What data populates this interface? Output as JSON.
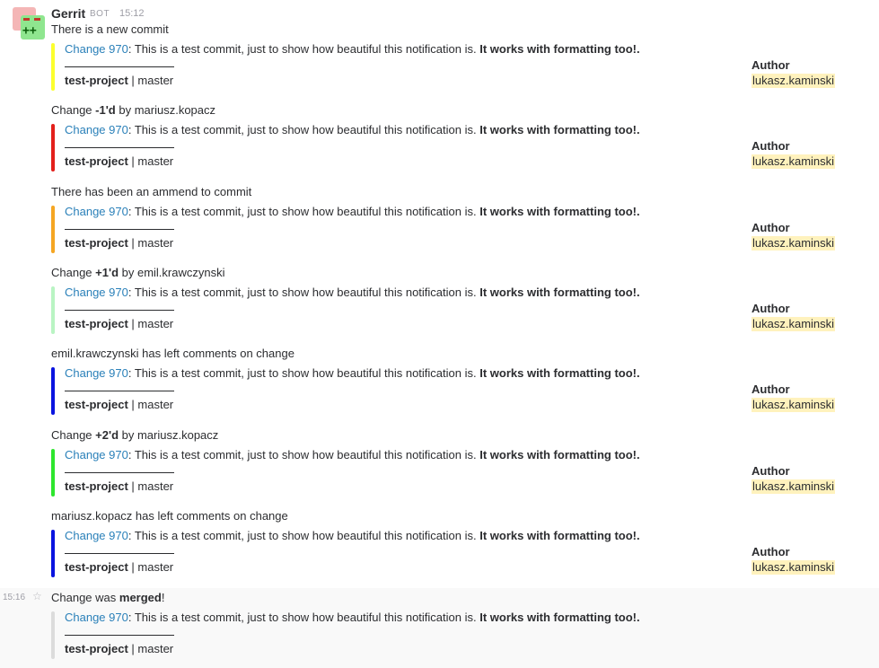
{
  "message": {
    "sender": "Gerrit",
    "bot_tag": "BOT",
    "time": "15:12"
  },
  "change_link": "Change 970",
  "change_desc": ": This is a test commit, just to show how beautiful this notification is. ",
  "change_bold": "It works with formatting too!.",
  "project": "test-project",
  "branch_sep": " | ",
  "branch": "master",
  "author_label": "Author",
  "author_value": "lukasz.kaminski",
  "notifications": [
    {
      "intro": [
        "There is a new commit"
      ],
      "bar_color": "#fcff2e"
    },
    {
      "intro": [
        "Change ",
        "-1'd",
        " by mariusz.kopacz"
      ],
      "bar_color": "#e3201b"
    },
    {
      "intro": [
        "There has been an ammend to commit"
      ],
      "bar_color": "#f5a623"
    },
    {
      "intro": [
        "Change ",
        "+1'd",
        " by emil.krawczynski"
      ],
      "bar_color": "#b9f4c3"
    },
    {
      "intro": [
        "emil.krawczynski has left comments on change"
      ],
      "bar_color": "#0a14e0"
    },
    {
      "intro": [
        "Change ",
        "+2'd",
        " by mariusz.kopacz"
      ],
      "bar_color": "#2ee62e"
    },
    {
      "intro": [
        "mariusz.kopacz has left comments on change"
      ],
      "bar_color": "#0a14e0"
    }
  ],
  "last": {
    "time": "15:16",
    "star_icon": "star-icon",
    "intro": [
      "Change was ",
      "merged",
      "!"
    ],
    "bar_color": "#dcdcdc"
  }
}
